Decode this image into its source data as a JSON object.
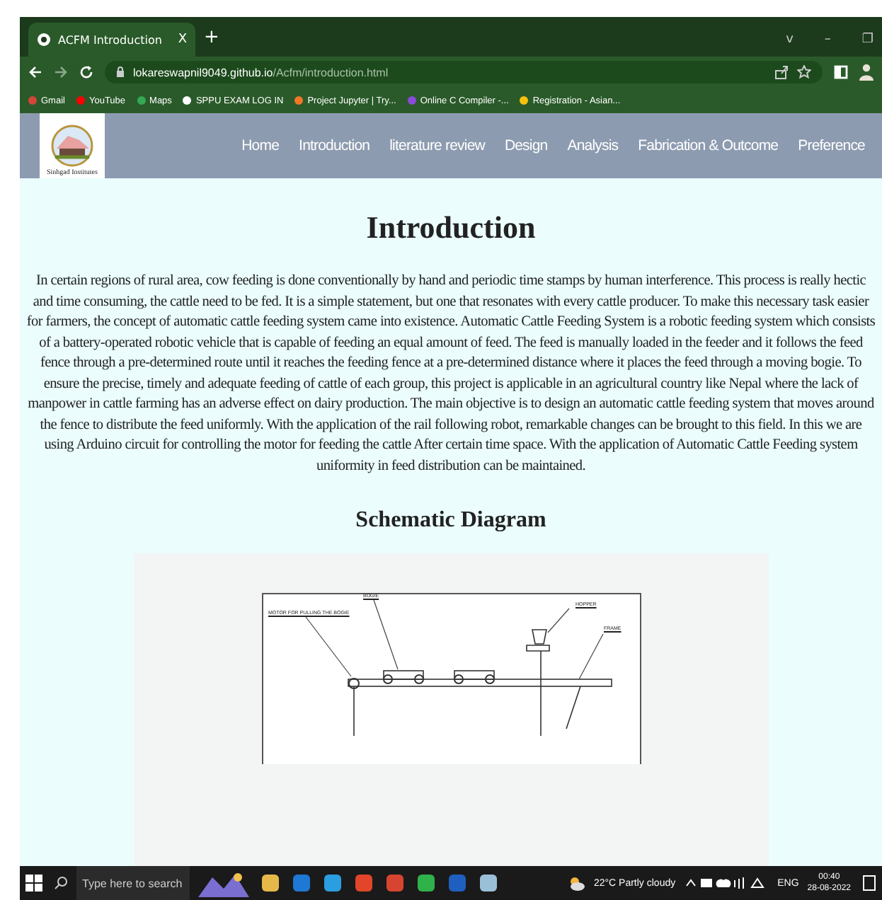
{
  "browser": {
    "tab": {
      "title": "ACFM Introduction",
      "close": "X",
      "new_tab": "+"
    },
    "window_controls": [
      "v",
      "–",
      "❐"
    ],
    "address": {
      "host": "lokareswapnil9049.github.io",
      "path": "/Acfm/introduction.html"
    },
    "bookmarks": [
      {
        "label": "Gmail",
        "color": "#d44638"
      },
      {
        "label": "YouTube",
        "color": "#ff0000"
      },
      {
        "label": "Maps",
        "color": "#34a853"
      },
      {
        "label": "SPPU EXAM LOG IN",
        "color": "#ffffff"
      },
      {
        "label": "Project Jupyter | Try...",
        "color": "#f37626"
      },
      {
        "label": "Online C Compiler -...",
        "color": "#8a4bd8"
      },
      {
        "label": "Registration - Asian...",
        "color": "#f4c20d"
      }
    ]
  },
  "site": {
    "logo_caption": "Sinhgad Institutes",
    "nav": [
      {
        "label": "Home",
        "selected": false
      },
      {
        "label": "Introduction",
        "selected": false
      },
      {
        "label": "literature review",
        "selected": false
      },
      {
        "label": "Design",
        "selected": false
      },
      {
        "label": "Analysis",
        "selected": false
      },
      {
        "label": "Fabrication & Outcome",
        "selected": false
      },
      {
        "label": "Preference",
        "selected": false
      }
    ],
    "heading": "Introduction",
    "paragraph": "In certain regions of rural area, cow feeding is done conventionally by hand and periodic time stamps by human interference. This process is really hectic and time consuming, the cattle need to be fed. It is a simple statement, but one that resonates with every cattle producer. To make this necessary task easier for farmers, the concept of automatic cattle feeding system came into existence. Automatic Cattle Feeding System is a robotic feeding system which consists of a battery-operated robotic vehicle that is capable of feeding an equal amount of feed. The feed is manually loaded in the feeder and it follows the feed fence through a pre-determined route until it reaches the feeding fence at a pre-determined distance where it places the feed through a moving bogie. To ensure the precise, timely and adequate feeding of cattle of each group, this project is applicable in an agricultural country like Nepal where the lack of manpower in cattle farming has an adverse effect on dairy production. The main objective is to design an automatic cattle feeding system that moves around the fence to distribute the feed uniformly. With the application of the rail following robot, remarkable changes can be brought to this field. In this we are using Arduino circuit for controlling the motor for feeding the cattle After certain time space. With the application of Automatic Cattle Feeding system uniformity in feed distribution can be maintained.",
    "subheading": "Schematic Diagram",
    "diagram_labels": {
      "motor": "MOTOR FOR PULLING THE BOGIE",
      "bogie": "BOGIE",
      "hopper": "HOPPER",
      "frame": "FRAME"
    }
  },
  "taskbar": {
    "search_placeholder": "Type here to search",
    "weather": "22°C  Partly cloudy",
    "language": "ENG",
    "time": "00:40",
    "date": "28-08-2022"
  }
}
